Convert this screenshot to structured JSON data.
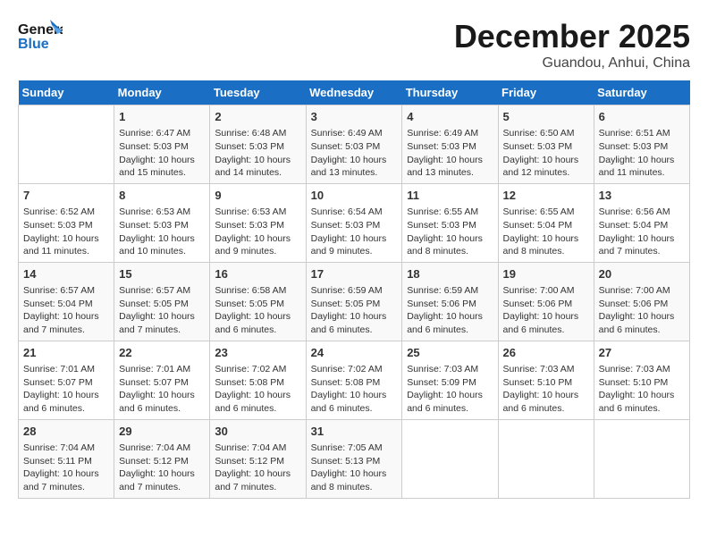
{
  "header": {
    "logo_line1": "General",
    "logo_line2": "Blue",
    "month": "December 2025",
    "location": "Guandou, Anhui, China"
  },
  "days_of_week": [
    "Sunday",
    "Monday",
    "Tuesday",
    "Wednesday",
    "Thursday",
    "Friday",
    "Saturday"
  ],
  "weeks": [
    [
      {
        "day": "",
        "info": ""
      },
      {
        "day": "1",
        "info": "Sunrise: 6:47 AM\nSunset: 5:03 PM\nDaylight: 10 hours\nand 15 minutes."
      },
      {
        "day": "2",
        "info": "Sunrise: 6:48 AM\nSunset: 5:03 PM\nDaylight: 10 hours\nand 14 minutes."
      },
      {
        "day": "3",
        "info": "Sunrise: 6:49 AM\nSunset: 5:03 PM\nDaylight: 10 hours\nand 13 minutes."
      },
      {
        "day": "4",
        "info": "Sunrise: 6:49 AM\nSunset: 5:03 PM\nDaylight: 10 hours\nand 13 minutes."
      },
      {
        "day": "5",
        "info": "Sunrise: 6:50 AM\nSunset: 5:03 PM\nDaylight: 10 hours\nand 12 minutes."
      },
      {
        "day": "6",
        "info": "Sunrise: 6:51 AM\nSunset: 5:03 PM\nDaylight: 10 hours\nand 11 minutes."
      }
    ],
    [
      {
        "day": "7",
        "info": "Sunrise: 6:52 AM\nSunset: 5:03 PM\nDaylight: 10 hours\nand 11 minutes."
      },
      {
        "day": "8",
        "info": "Sunrise: 6:53 AM\nSunset: 5:03 PM\nDaylight: 10 hours\nand 10 minutes."
      },
      {
        "day": "9",
        "info": "Sunrise: 6:53 AM\nSunset: 5:03 PM\nDaylight: 10 hours\nand 9 minutes."
      },
      {
        "day": "10",
        "info": "Sunrise: 6:54 AM\nSunset: 5:03 PM\nDaylight: 10 hours\nand 9 minutes."
      },
      {
        "day": "11",
        "info": "Sunrise: 6:55 AM\nSunset: 5:03 PM\nDaylight: 10 hours\nand 8 minutes."
      },
      {
        "day": "12",
        "info": "Sunrise: 6:55 AM\nSunset: 5:04 PM\nDaylight: 10 hours\nand 8 minutes."
      },
      {
        "day": "13",
        "info": "Sunrise: 6:56 AM\nSunset: 5:04 PM\nDaylight: 10 hours\nand 7 minutes."
      }
    ],
    [
      {
        "day": "14",
        "info": "Sunrise: 6:57 AM\nSunset: 5:04 PM\nDaylight: 10 hours\nand 7 minutes."
      },
      {
        "day": "15",
        "info": "Sunrise: 6:57 AM\nSunset: 5:05 PM\nDaylight: 10 hours\nand 7 minutes."
      },
      {
        "day": "16",
        "info": "Sunrise: 6:58 AM\nSunset: 5:05 PM\nDaylight: 10 hours\nand 6 minutes."
      },
      {
        "day": "17",
        "info": "Sunrise: 6:59 AM\nSunset: 5:05 PM\nDaylight: 10 hours\nand 6 minutes."
      },
      {
        "day": "18",
        "info": "Sunrise: 6:59 AM\nSunset: 5:06 PM\nDaylight: 10 hours\nand 6 minutes."
      },
      {
        "day": "19",
        "info": "Sunrise: 7:00 AM\nSunset: 5:06 PM\nDaylight: 10 hours\nand 6 minutes."
      },
      {
        "day": "20",
        "info": "Sunrise: 7:00 AM\nSunset: 5:06 PM\nDaylight: 10 hours\nand 6 minutes."
      }
    ],
    [
      {
        "day": "21",
        "info": "Sunrise: 7:01 AM\nSunset: 5:07 PM\nDaylight: 10 hours\nand 6 minutes."
      },
      {
        "day": "22",
        "info": "Sunrise: 7:01 AM\nSunset: 5:07 PM\nDaylight: 10 hours\nand 6 minutes."
      },
      {
        "day": "23",
        "info": "Sunrise: 7:02 AM\nSunset: 5:08 PM\nDaylight: 10 hours\nand 6 minutes."
      },
      {
        "day": "24",
        "info": "Sunrise: 7:02 AM\nSunset: 5:08 PM\nDaylight: 10 hours\nand 6 minutes."
      },
      {
        "day": "25",
        "info": "Sunrise: 7:03 AM\nSunset: 5:09 PM\nDaylight: 10 hours\nand 6 minutes."
      },
      {
        "day": "26",
        "info": "Sunrise: 7:03 AM\nSunset: 5:10 PM\nDaylight: 10 hours\nand 6 minutes."
      },
      {
        "day": "27",
        "info": "Sunrise: 7:03 AM\nSunset: 5:10 PM\nDaylight: 10 hours\nand 6 minutes."
      }
    ],
    [
      {
        "day": "28",
        "info": "Sunrise: 7:04 AM\nSunset: 5:11 PM\nDaylight: 10 hours\nand 7 minutes."
      },
      {
        "day": "29",
        "info": "Sunrise: 7:04 AM\nSunset: 5:12 PM\nDaylight: 10 hours\nand 7 minutes."
      },
      {
        "day": "30",
        "info": "Sunrise: 7:04 AM\nSunset: 5:12 PM\nDaylight: 10 hours\nand 7 minutes."
      },
      {
        "day": "31",
        "info": "Sunrise: 7:05 AM\nSunset: 5:13 PM\nDaylight: 10 hours\nand 8 minutes."
      },
      {
        "day": "",
        "info": ""
      },
      {
        "day": "",
        "info": ""
      },
      {
        "day": "",
        "info": ""
      }
    ]
  ]
}
